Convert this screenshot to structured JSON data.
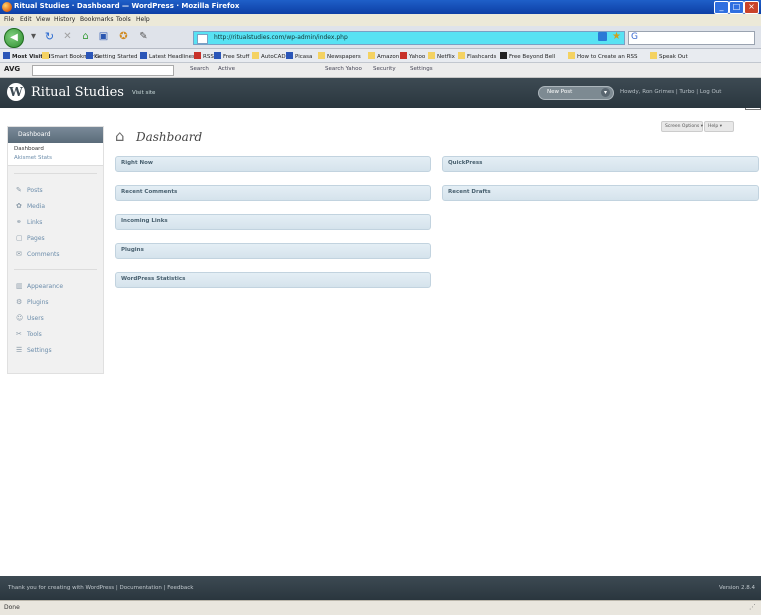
{
  "window": {
    "title": "Ritual Studies · Dashboard — WordPress · Mozilla Firefox",
    "controls": [
      "_",
      "□",
      "×"
    ]
  },
  "browser_menu": [
    "File",
    "Edit",
    "View",
    "History",
    "Bookmarks",
    "Tools",
    "Help"
  ],
  "address_bar": {
    "url": "http://ritualstudies.com/wp-admin/index.php"
  },
  "bookmarks": [
    "Most Visited",
    "Smart Bookmarks",
    "Getting Started",
    "Latest Headlines",
    "RSS",
    "Free Stuff",
    "AutoCAD",
    "Picasa",
    "Newspapers",
    "Amazon",
    "Yahoo",
    "Netflix",
    "Flashcards",
    "Free Beyond Bell",
    "How to Create an RSS",
    "Speak Out"
  ],
  "avg_toolbar": {
    "logo": "AVG",
    "items": [
      "Search",
      "Active",
      "Search Yahoo",
      "Security",
      "Settings"
    ]
  },
  "wp_header": {
    "logo": "W",
    "site_title": "Ritual Studies",
    "visit_site": "Visit site",
    "new_post": "New Post",
    "user_links": "Howdy, Ron Grimes | Turbo | Log Out"
  },
  "screen_options": "Screen Options ▾",
  "help": "Help ▾",
  "admin_menu": {
    "active": "Dashboard",
    "submenu": [
      "Dashboard",
      "Akismet Stats"
    ],
    "group1": [
      {
        "icon": "✎",
        "label": "Posts"
      },
      {
        "icon": "✿",
        "label": "Media"
      },
      {
        "icon": "⚭",
        "label": "Links"
      },
      {
        "icon": "▢",
        "label": "Pages"
      },
      {
        "icon": "✉",
        "label": "Comments"
      }
    ],
    "group2": [
      {
        "icon": "▥",
        "label": "Appearance"
      },
      {
        "icon": "⚙",
        "label": "Plugins"
      },
      {
        "icon": "☺",
        "label": "Users"
      },
      {
        "icon": "✂",
        "label": "Tools"
      },
      {
        "icon": "☰",
        "label": "Settings"
      }
    ]
  },
  "page_title": "Dashboard",
  "left_boxes": [
    "Right Now",
    "Recent Comments",
    "Incoming Links",
    "Plugins",
    "WordPress Statistics"
  ],
  "right_boxes": [
    "QuickPress",
    "Recent Drafts"
  ],
  "footer": {
    "left": "Thank you for creating with WordPress | Documentation | Feedback",
    "right": "Version 2.8.4"
  },
  "status_bar": {
    "text": "Done",
    "grip": "⋰"
  }
}
